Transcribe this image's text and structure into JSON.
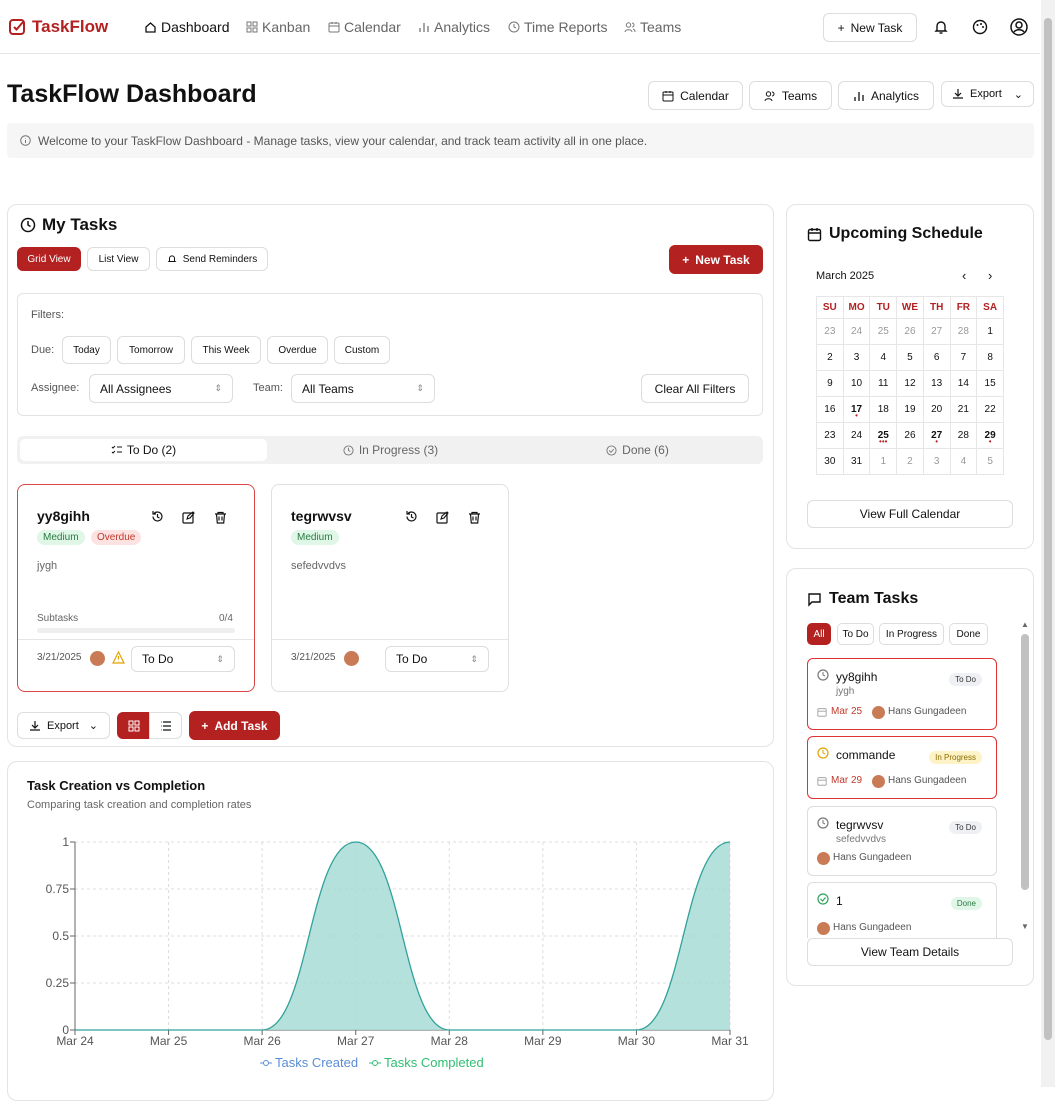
{
  "app": {
    "brand": "TaskFlow"
  },
  "nav": {
    "items": [
      "Dashboard",
      "Kanban",
      "Calendar",
      "Analytics",
      "Time Reports",
      "Teams"
    ],
    "new_task": "New Task"
  },
  "page": {
    "title": "TaskFlow Dashboard",
    "info": "Welcome to your TaskFlow Dashboard - Manage tasks, view your calendar, and track team activity all in one place.",
    "actions": [
      "Calendar",
      "Teams",
      "Analytics",
      "Export"
    ]
  },
  "tasks": {
    "title": "My Tasks",
    "views": [
      "Grid View",
      "List View",
      "Send Reminders"
    ],
    "new_task": "New Task",
    "filters": {
      "label": "Filters:",
      "due_label": "Due:",
      "due": [
        "Today",
        "Tomorrow",
        "This Week",
        "Overdue",
        "Custom"
      ],
      "assignee_label": "Assignee:",
      "assignee_value": "All Assignees",
      "team_label": "Team:",
      "team_value": "All Teams",
      "clear": "Clear All Filters"
    },
    "tabs": [
      "To Do (2)",
      "In Progress (3)",
      "Done (6)"
    ],
    "cards": [
      {
        "title": "yy8gihh",
        "priority": "Medium",
        "overdue": "Overdue",
        "desc": "jygh",
        "subtasks_label": "Subtasks",
        "subtasks_count": "0/4",
        "date": "3/21/2025",
        "status": "To Do"
      },
      {
        "title": "tegrwvsv",
        "priority": "Medium",
        "desc": "sefedvvdvs",
        "date": "3/21/2025",
        "status": "To Do"
      }
    ],
    "export": "Export",
    "add_task": "Add Task"
  },
  "schedule": {
    "title": "Upcoming Schedule",
    "month": "March 2025",
    "days": [
      "SU",
      "MO",
      "TU",
      "WE",
      "TH",
      "FR",
      "SA"
    ],
    "weeks": [
      [
        "23",
        "24",
        "25",
        "26",
        "27",
        "28",
        "1"
      ],
      [
        "2",
        "3",
        "4",
        "5",
        "6",
        "7",
        "8"
      ],
      [
        "9",
        "10",
        "11",
        "12",
        "13",
        "14",
        "15"
      ],
      [
        "16",
        "17",
        "18",
        "19",
        "20",
        "21",
        "22"
      ],
      [
        "23",
        "24",
        "25",
        "26",
        "27",
        "28",
        "29"
      ],
      [
        "30",
        "31",
        "1",
        "2",
        "3",
        "4",
        "5"
      ]
    ],
    "view_full": "View Full Calendar"
  },
  "team": {
    "title": "Team Tasks",
    "filters": [
      "All",
      "To Do",
      "In Progress",
      "Done"
    ],
    "items": [
      {
        "title": "yy8gihh",
        "sub": "jygh",
        "badge": "To Do",
        "date": "Mar 25",
        "person": "Hans Gungadeen"
      },
      {
        "title": "commande",
        "badge": "In Progress",
        "date": "Mar 29",
        "person": "Hans Gungadeen"
      },
      {
        "title": "tegrwvsv",
        "sub": "sefedvvdvs",
        "badge": "To Do",
        "person": "Hans Gungadeen"
      },
      {
        "title": "1",
        "badge": "Done",
        "person": "Hans Gungadeen"
      }
    ],
    "view_details": "View Team Details"
  },
  "chart": {
    "title": "Task Creation vs Completion",
    "subtitle": "Comparing task creation and completion rates"
  },
  "chart_data": {
    "type": "area",
    "x": [
      "Mar 24",
      "Mar 25",
      "Mar 26",
      "Mar 27",
      "Mar 28",
      "Mar 29",
      "Mar 30",
      "Mar 31"
    ],
    "series": [
      {
        "name": "Tasks Created",
        "values": [
          0,
          0,
          0,
          1,
          0,
          0,
          0,
          1
        ]
      },
      {
        "name": "Tasks Completed",
        "values": [
          0,
          0,
          0,
          1,
          0,
          0,
          0,
          1
        ]
      }
    ],
    "yticks": [
      "0",
      "0.25",
      "0.5",
      "0.75",
      "1"
    ],
    "ylim": [
      0,
      1
    ],
    "grid": true,
    "legend": "bottom",
    "colors": {
      "created": "#5b8dd6",
      "completed": "#2fbf71",
      "fill": "#a8dcd6"
    }
  }
}
